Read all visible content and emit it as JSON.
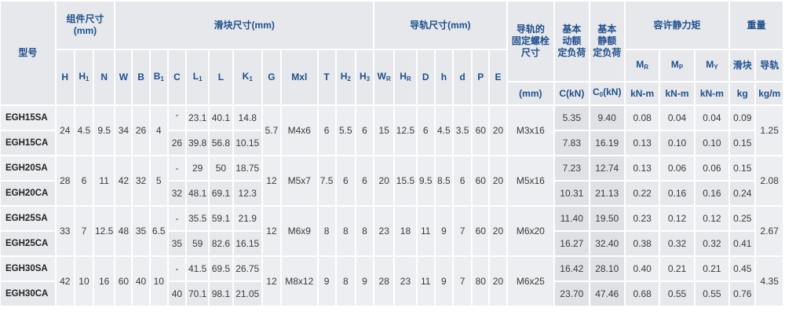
{
  "headers": {
    "model": "型号",
    "assembly_group": "组件尺寸\n(mm)",
    "block_group": "滑块尺寸(mm)",
    "rail_group": "导轨尺寸(mm)",
    "bolt_group": "导轨的\n固定螺栓\n尺寸",
    "bolt_unit": "(mm)",
    "dyn_load": "基本\n动额\n定负荷",
    "dyn_load_unit": "C(kN)",
    "static_load": "基本\n静额\n定负荷",
    "static_load_unit": "C",
    "static_load_unit_sub": "0",
    "static_load_unit_suffix": "(kN)",
    "moment_group": "容许静力矩",
    "weight_group": "重量",
    "moment_r": "M",
    "moment_r_sub": "R",
    "moment_p": "M",
    "moment_p_sub": "P",
    "moment_y": "M",
    "moment_y_sub": "Y",
    "moment_unit": "kN-m",
    "weight_block": "滑块",
    "weight_rail": "导轨",
    "weight_block_unit": "kg",
    "weight_rail_unit": "kg/m",
    "H": "H",
    "H1": "H",
    "H1_sub": "1",
    "N": "N",
    "W": "W",
    "B": "B",
    "B1": "B",
    "B1_sub": "1",
    "C": "C",
    "L1": "L",
    "L1_sub": "1",
    "L": "L",
    "K1": "K",
    "K1_sub": "1",
    "G": "G",
    "Mxl": "Mxl",
    "T": "T",
    "H2": "H",
    "H2_sub": "2",
    "H3": "H",
    "H3_sub": "3",
    "WR": "W",
    "WR_sub": "R",
    "HR": "H",
    "HR_sub": "R",
    "D": "D",
    "h": "h",
    "d": "d",
    "P": "P",
    "E": "E"
  },
  "groups": [
    {
      "H": "24",
      "H1": "4.5",
      "N": "9.5",
      "W": "34",
      "B": "26",
      "B1": "4",
      "G": "5.7",
      "Mxl": "M4x6",
      "T": "6",
      "H2": "5.5",
      "H3": "6",
      "WR": "15",
      "HR": "12.5",
      "D": "6",
      "h": "4.5",
      "d": "3.5",
      "P": "60",
      "E": "20",
      "bolt": "M3x16",
      "rail_weight": "1.25",
      "rows": [
        {
          "model": "EGH15SA",
          "C": "-",
          "L1": "23.1",
          "L": "40.1",
          "K1": "14.8",
          "dyn": "5.35",
          "static": "9.40",
          "MR": "0.08",
          "MP": "0.04",
          "MY": "0.04",
          "block_weight": "0.09"
        },
        {
          "model": "EGH15CA",
          "C": "26",
          "L1": "39.8",
          "L": "56.8",
          "K1": "10.15",
          "dyn": "7.83",
          "static": "16.19",
          "MR": "0.13",
          "MP": "0.10",
          "MY": "0.10",
          "block_weight": "0.15"
        }
      ]
    },
    {
      "H": "28",
      "H1": "6",
      "N": "11",
      "W": "42",
      "B": "32",
      "B1": "5",
      "G": "12",
      "Mxl": "M5x7",
      "T": "7.5",
      "H2": "6",
      "H3": "6",
      "WR": "20",
      "HR": "15.5",
      "D": "9.5",
      "h": "8.5",
      "d": "6",
      "P": "60",
      "E": "20",
      "bolt": "M5x16",
      "rail_weight": "2.08",
      "rows": [
        {
          "model": "EGH20SA",
          "C": "-",
          "L1": "29",
          "L": "50",
          "K1": "18.75",
          "dyn": "7.23",
          "static": "12.74",
          "MR": "0.13",
          "MP": "0.06",
          "MY": "0.06",
          "block_weight": "0.15"
        },
        {
          "model": "EGH20CA",
          "C": "32",
          "L1": "48.1",
          "L": "69.1",
          "K1": "12.3",
          "dyn": "10.31",
          "static": "21.13",
          "MR": "0.22",
          "MP": "0.16",
          "MY": "0.16",
          "block_weight": "0.24"
        }
      ]
    },
    {
      "H": "33",
      "H1": "7",
      "N": "12.5",
      "W": "48",
      "B": "35",
      "B1": "6.5",
      "G": "12",
      "Mxl": "M6x9",
      "T": "8",
      "H2": "8",
      "H3": "8",
      "WR": "23",
      "HR": "18",
      "D": "11",
      "h": "9",
      "d": "7",
      "P": "60",
      "E": "20",
      "bolt": "M6x20",
      "rail_weight": "2.67",
      "rows": [
        {
          "model": "EGH25SA",
          "C": "-",
          "L1": "35.5",
          "L": "59.1",
          "K1": "21.9",
          "dyn": "11.40",
          "static": "19.50",
          "MR": "0.23",
          "MP": "0.12",
          "MY": "0.12",
          "block_weight": "0.25"
        },
        {
          "model": "EGH25CA",
          "C": "35",
          "L1": "59",
          "L": "82.6",
          "K1": "16.15",
          "dyn": "16.27",
          "static": "32.40",
          "MR": "0.38",
          "MP": "0.32",
          "MY": "0.32",
          "block_weight": "0.41"
        }
      ]
    },
    {
      "H": "42",
      "H1": "10",
      "N": "16",
      "W": "60",
      "B": "40",
      "B1": "10",
      "G": "12",
      "Mxl": "M8x12",
      "T": "9",
      "H2": "8",
      "H3": "9",
      "WR": "28",
      "HR": "23",
      "D": "11",
      "h": "9",
      "d": "7",
      "P": "80",
      "E": "20",
      "bolt": "M6x25",
      "rail_weight": "4.35",
      "rows": [
        {
          "model": "EGH30SA",
          "C": "-",
          "L1": "41.5",
          "L": "69.5",
          "K1": "26.75",
          "dyn": "16.42",
          "static": "28.10",
          "MR": "0.40",
          "MP": "0.21",
          "MY": "0.21",
          "block_weight": "0.45"
        },
        {
          "model": "EGH30CA",
          "C": "40",
          "L1": "70.1",
          "L": "98.1",
          "K1": "21.05",
          "dyn": "23.70",
          "static": "47.46",
          "MR": "0.68",
          "MP": "0.55",
          "MY": "0.55",
          "block_weight": "0.76"
        }
      ]
    }
  ]
}
